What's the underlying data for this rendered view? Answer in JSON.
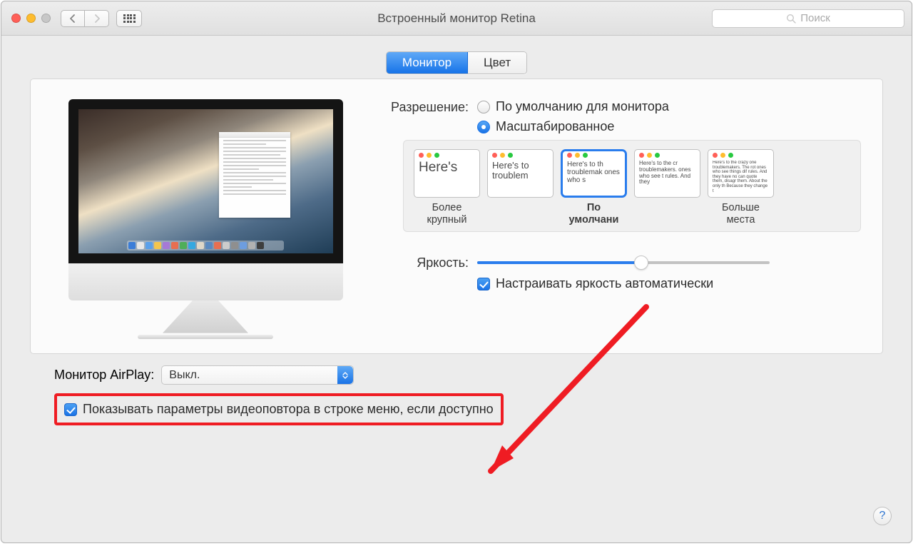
{
  "window": {
    "title": "Встроенный монитор Retina"
  },
  "search": {
    "placeholder": "Поиск"
  },
  "tabs": {
    "monitor": "Монитор",
    "color": "Цвет"
  },
  "resolution": {
    "label": "Разрешение:",
    "default": "По умолчанию для монитора",
    "scaled": "Масштабированное",
    "options": [
      {
        "caption": "Более крупный",
        "sample": "Here's",
        "fs": 19
      },
      {
        "caption": "",
        "sample": "Here's to troublem",
        "fs": 13
      },
      {
        "caption": "По умолчани",
        "sample": "Here's to th troublemak ones who s",
        "fs": 10
      },
      {
        "caption": "",
        "sample": "Here's to the cr troublemakers. ones who see t rules. And they",
        "fs": 8
      },
      {
        "caption": "Больше места",
        "sample": "Here's to the crazy one troublemakers. The rot ones who see things dif rules. And they have no can quote them, disagr them. About the only th Because they change t",
        "fs": 6
      }
    ]
  },
  "brightness": {
    "label": "Яркость:"
  },
  "auto_brightness": "Настраивать яркость автоматически",
  "airplay": {
    "label": "Монитор AirPlay:",
    "value": "Выкл."
  },
  "mirroring_checkbox": "Показывать параметры видеоповтора в строке меню, если доступно",
  "help": "?"
}
